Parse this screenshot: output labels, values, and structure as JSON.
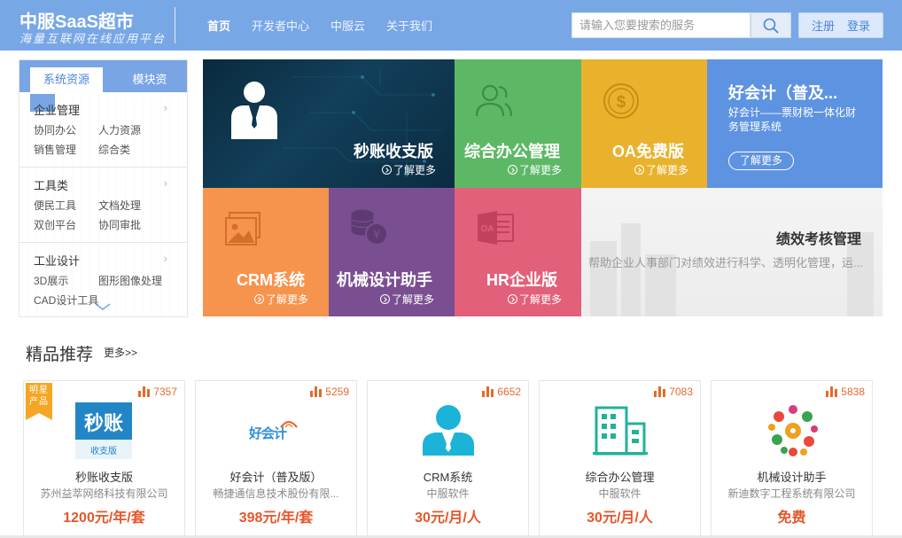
{
  "header": {
    "logo_title": "中服SaaS超市",
    "logo_sub": "海量互联网在线应用平台",
    "nav": [
      "首页",
      "开发者中心",
      "中服云",
      "关于我们"
    ],
    "search_placeholder": "请输入您要搜索的服务",
    "register": "注册",
    "login": "登录"
  },
  "sidebar": {
    "tabs": [
      "系统资源",
      "模块资"
    ],
    "groups": [
      {
        "title": "企业管理",
        "links": [
          "协同办公",
          "人力资源",
          "销售管理",
          "综合类"
        ]
      },
      {
        "title": "工具类",
        "links": [
          "便民工具",
          "文档处理",
          "双创平台",
          "协同审批"
        ]
      },
      {
        "title": "工业设计",
        "links": [
          "3D展示",
          "图形图像处理",
          "CAD设计工具"
        ]
      }
    ]
  },
  "tiles": {
    "more_label": "了解更多",
    "items": [
      {
        "title": "秒账收支版",
        "color": "#0d3148",
        "icon": "businessman-icon"
      },
      {
        "title": "综合办公管理",
        "color": "#5db866",
        "icon": "users-icon"
      },
      {
        "title": "OA免费版",
        "color": "#e9b22d",
        "icon": "dollar-coin-icon"
      },
      {
        "title": "好会计（普及...",
        "color": "#5e93e1",
        "desc": "好会计——票财税一体化财务管理系统",
        "icon": ""
      },
      {
        "title": "CRM系统",
        "color": "#f6944e",
        "icon": "picture-icon"
      },
      {
        "title": "机械设计助手",
        "color": "#7a4f91",
        "icon": "coins-icon"
      },
      {
        "title": "HR企业版",
        "color": "#e2607a",
        "icon": "office-doc-icon"
      },
      {
        "title": "绩效考核管理",
        "color": "#f2f2f2",
        "desc": "帮助企业人事部门对绩效进行科学、透明化管理，运...",
        "icon": ""
      }
    ]
  },
  "recommend": {
    "title": "精品推荐",
    "more": "更多>>",
    "ribbon": "明星产品",
    "cards": [
      {
        "name": "秒账收支版",
        "vendor": "苏州益萃网络科技有限公司",
        "price": "1200元/年/套",
        "count": "7357",
        "logo_main": "秒账",
        "logo_sub": "收支版",
        "icon": "miaozhang-logo-icon"
      },
      {
        "name": "好会计（普及版）",
        "vendor": "畅捷通信息技术股份有限...",
        "price": "398元/年/套",
        "count": "5259",
        "logo_main": "好会计",
        "icon": "haokuaiji-logo-icon"
      },
      {
        "name": "CRM系统",
        "vendor": "中服软件",
        "price": "30元/月/人",
        "count": "6652",
        "icon": "crm-person-icon"
      },
      {
        "name": "综合办公管理",
        "vendor": "中服软件",
        "price": "30元/月/人",
        "count": "7083",
        "icon": "office-building-icon"
      },
      {
        "name": "机械设计助手",
        "vendor": "新迪数字工程系统有限公司",
        "price": "免费",
        "count": "5838",
        "icon": "gears-icon"
      }
    ]
  }
}
